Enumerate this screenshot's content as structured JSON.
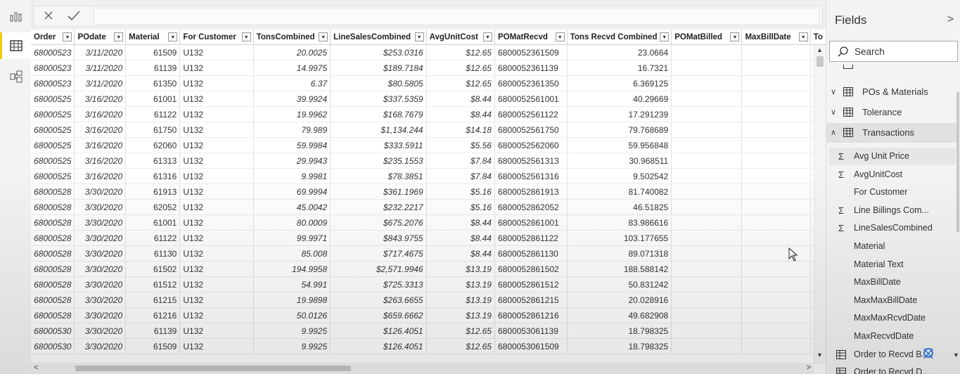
{
  "formula_bar": {
    "cancel_icon": "close-icon",
    "commit_icon": "check-icon"
  },
  "table": {
    "columns": [
      "Order",
      "POdate",
      "Material",
      "For Customer",
      "TonsCombined",
      "LineSalesCombined",
      "AvgUnitCost",
      "POMatRecvd",
      "Tons Recvd Combined",
      "POMatBilled",
      "MaxBillDate",
      "To"
    ],
    "rows": [
      [
        "68000523",
        "3/11/2020",
        "61509",
        "U132",
        "20.0025",
        "$253.0316",
        "$12.65",
        "6800052361509",
        "23.0664",
        "",
        ""
      ],
      [
        "68000523",
        "3/11/2020",
        "61139",
        "U132",
        "14.9975",
        "$189.7184",
        "$12.65",
        "6800052361139",
        "16.7321",
        "",
        ""
      ],
      [
        "68000523",
        "3/11/2020",
        "61350",
        "U132",
        "6.37",
        "$80.5805",
        "$12.65",
        "6800052361350",
        "6.369125",
        "",
        ""
      ],
      [
        "68000525",
        "3/16/2020",
        "61001",
        "U132",
        "39.9924",
        "$337.5359",
        "$8.44",
        "6800052561001",
        "40.29669",
        "",
        ""
      ],
      [
        "68000525",
        "3/16/2020",
        "61122",
        "U132",
        "19.9962",
        "$168.7679",
        "$8.44",
        "6800052561122",
        "17.291239",
        "",
        ""
      ],
      [
        "68000525",
        "3/16/2020",
        "61750",
        "U132",
        "79.989",
        "$1,134.244",
        "$14.18",
        "6800052561750",
        "79.768689",
        "",
        ""
      ],
      [
        "68000525",
        "3/16/2020",
        "62060",
        "U132",
        "59.9984",
        "$333.5911",
        "$5.56",
        "6800052562060",
        "59.956848",
        "",
        ""
      ],
      [
        "68000525",
        "3/16/2020",
        "61313",
        "U132",
        "29.9943",
        "$235.1553",
        "$7.84",
        "6800052561313",
        "30.968511",
        "",
        ""
      ],
      [
        "68000525",
        "3/16/2020",
        "61316",
        "U132",
        "9.9981",
        "$78.3851",
        "$7.84",
        "6800052561316",
        "9.502542",
        "",
        ""
      ],
      [
        "68000528",
        "3/30/2020",
        "61913",
        "U132",
        "69.9994",
        "$361.1969",
        "$5.16",
        "6800052861913",
        "81.740082",
        "",
        ""
      ],
      [
        "68000528",
        "3/30/2020",
        "62052",
        "U132",
        "45.0042",
        "$232.2217",
        "$5.16",
        "6800052862052",
        "46.51825",
        "",
        ""
      ],
      [
        "68000528",
        "3/30/2020",
        "61001",
        "U132",
        "80.0009",
        "$675.2076",
        "$8.44",
        "6800052861001",
        "83.986616",
        "",
        ""
      ],
      [
        "68000528",
        "3/30/2020",
        "61122",
        "U132",
        "99.9971",
        "$843.9755",
        "$8.44",
        "6800052861122",
        "103.177655",
        "",
        ""
      ],
      [
        "68000528",
        "3/30/2020",
        "61130",
        "U132",
        "85.008",
        "$717.4675",
        "$8.44",
        "6800052861130",
        "89.071318",
        "",
        ""
      ],
      [
        "68000528",
        "3/30/2020",
        "61502",
        "U132",
        "194.9958",
        "$2,571.9946",
        "$13.19",
        "6800052861502",
        "188.588142",
        "",
        ""
      ],
      [
        "68000528",
        "3/30/2020",
        "61512",
        "U132",
        "54.991",
        "$725.3313",
        "$13.19",
        "6800052861512",
        "50.831242",
        "",
        ""
      ],
      [
        "68000528",
        "3/30/2020",
        "61215",
        "U132",
        "19.9898",
        "$263.6655",
        "$13.19",
        "6800052861215",
        "20.028916",
        "",
        ""
      ],
      [
        "68000528",
        "3/30/2020",
        "61216",
        "U132",
        "50.0126",
        "$659.6662",
        "$13.19",
        "6800052861216",
        "49.682908",
        "",
        ""
      ],
      [
        "68000530",
        "3/30/2020",
        "61139",
        "U132",
        "9.9925",
        "$126.4051",
        "$12.65",
        "6800053061139",
        "18.798325",
        "",
        ""
      ],
      [
        "68000530",
        "3/30/2020",
        "61509",
        "U132",
        "9.9925",
        "$126.4051",
        "$12.65",
        "6800053061509",
        "18.798325",
        "",
        ""
      ]
    ]
  },
  "fields_panel": {
    "title": "Fields",
    "search_placeholder": "Search",
    "tables": [
      {
        "name": "POs & Materials",
        "expanded": false
      },
      {
        "name": "Tolerance",
        "expanded": false
      },
      {
        "name": "Transactions",
        "expanded": true
      }
    ],
    "fields": [
      {
        "name": "Avg Unit Price",
        "icon": "sigma"
      },
      {
        "name": "AvgUnitCost",
        "icon": "sigma"
      },
      {
        "name": "For Customer",
        "icon": ""
      },
      {
        "name": "Line Billings Com...",
        "icon": "sigma"
      },
      {
        "name": "LineSalesCombined",
        "icon": "sigma"
      },
      {
        "name": "Material",
        "icon": ""
      },
      {
        "name": "Material Text",
        "icon": ""
      },
      {
        "name": "MaxBillDate",
        "icon": ""
      },
      {
        "name": "MaxMaxBillDate",
        "icon": ""
      },
      {
        "name": "MaxMaxRcvdDate",
        "icon": ""
      },
      {
        "name": "MaxRecvdDate",
        "icon": ""
      },
      {
        "name": "Order to Recvd B...",
        "icon": "table"
      },
      {
        "name": "Order to Recvd D...",
        "icon": "table"
      }
    ]
  },
  "colors": {
    "accent": "#f2c811",
    "selected_row": "#e1e1e1"
  }
}
